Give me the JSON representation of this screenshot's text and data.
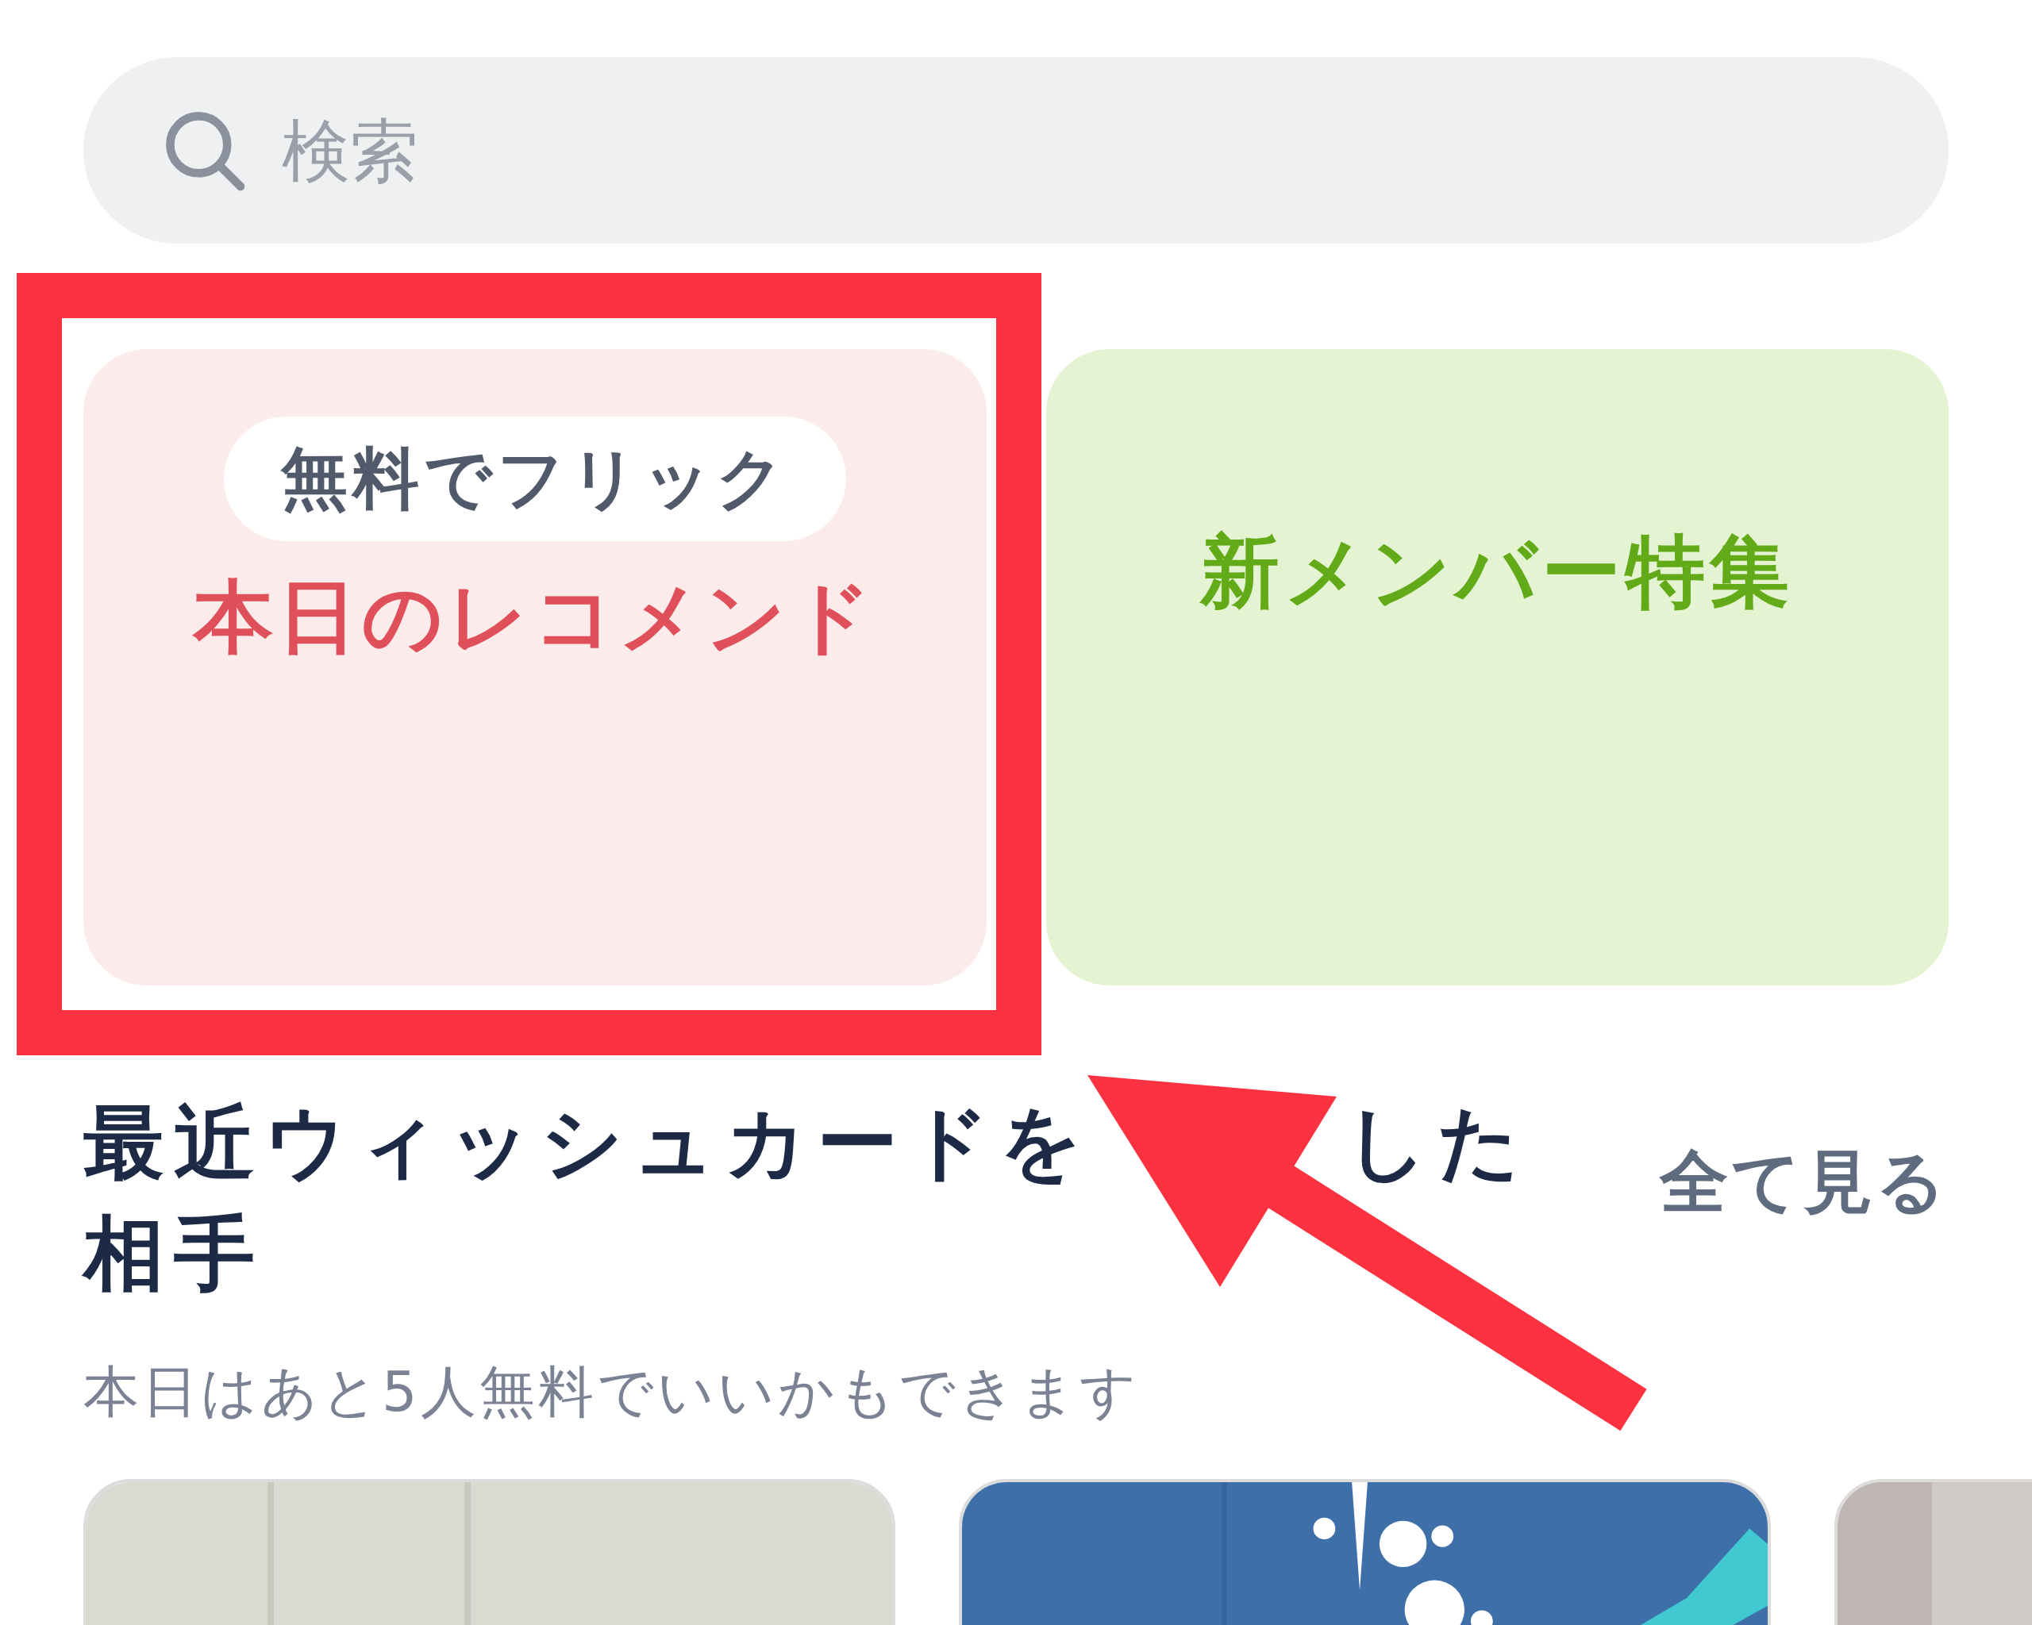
{
  "search": {
    "placeholder": "検索"
  },
  "banners": [
    {
      "kind": "badge_title",
      "badge": "無料でフリック",
      "title": "本日のレコメンド"
    },
    {
      "kind": "title",
      "title": "新メンバー特集"
    }
  ],
  "section": {
    "title_parts": [
      "最近ウィッシュカードを",
      "した",
      "相手"
    ],
    "see_all": "全て見る",
    "subtitle": "本日はあと5人無料でいいかもできます"
  }
}
